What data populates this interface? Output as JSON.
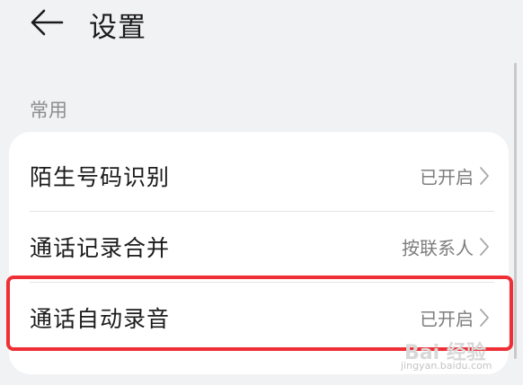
{
  "header": {
    "title": "设置",
    "back_icon": "arrow-left-icon"
  },
  "section": {
    "label": "常用",
    "rows": [
      {
        "label": "陌生号码识别",
        "value": "已开启"
      },
      {
        "label": "通话记录合并",
        "value": "按联系人"
      },
      {
        "label": "通话自动录音",
        "value": "已开启"
      }
    ]
  },
  "highlight": {
    "color": "#ee2f35"
  },
  "watermark": {
    "line1": "Bai 经验",
    "line2": "jingyan.baidu.com"
  }
}
